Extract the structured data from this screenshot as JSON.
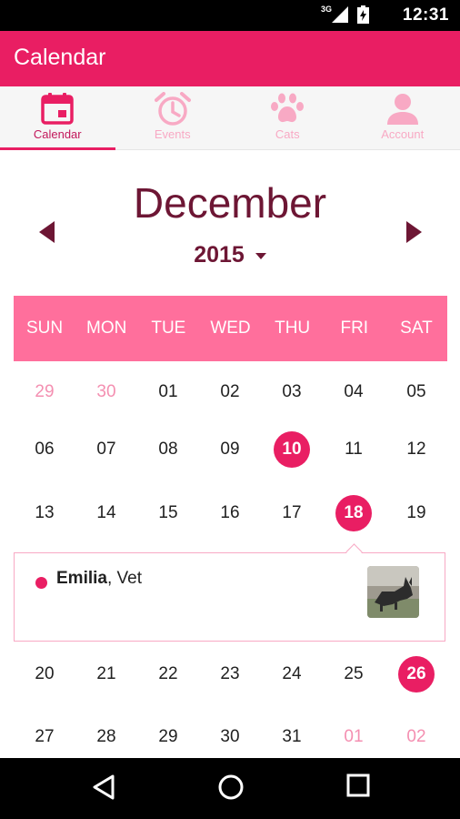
{
  "status_bar": {
    "network": "3G",
    "time": "12:31"
  },
  "app_bar": {
    "title": "Calendar"
  },
  "tabs": [
    {
      "label": "Calendar",
      "icon": "calendar-icon",
      "active": true
    },
    {
      "label": "Events",
      "icon": "alarm-clock-icon",
      "active": false
    },
    {
      "label": "Cats",
      "icon": "paw-icon",
      "active": false
    },
    {
      "label": "Account",
      "icon": "person-icon",
      "active": false
    }
  ],
  "calendar": {
    "month": "December",
    "year": "2015",
    "weekdays": [
      "SUN",
      "MON",
      "TUE",
      "WED",
      "THU",
      "FRI",
      "SAT"
    ],
    "weeks": [
      [
        {
          "d": "29",
          "muted": true
        },
        {
          "d": "30",
          "muted": true
        },
        {
          "d": "01"
        },
        {
          "d": "02"
        },
        {
          "d": "03"
        },
        {
          "d": "04"
        },
        {
          "d": "05"
        }
      ],
      [
        {
          "d": "06"
        },
        {
          "d": "07"
        },
        {
          "d": "08"
        },
        {
          "d": "09"
        },
        {
          "d": "10",
          "event": true
        },
        {
          "d": "11"
        },
        {
          "d": "12"
        }
      ],
      [
        {
          "d": "13"
        },
        {
          "d": "14"
        },
        {
          "d": "15"
        },
        {
          "d": "16"
        },
        {
          "d": "17"
        },
        {
          "d": "18",
          "event": true
        },
        {
          "d": "19"
        }
      ],
      [
        {
          "d": "20"
        },
        {
          "d": "21"
        },
        {
          "d": "22"
        },
        {
          "d": "23"
        },
        {
          "d": "24"
        },
        {
          "d": "25"
        },
        {
          "d": "26",
          "event": true
        }
      ],
      [
        {
          "d": "27"
        },
        {
          "d": "28"
        },
        {
          "d": "29"
        },
        {
          "d": "30"
        },
        {
          "d": "31"
        },
        {
          "d": "01",
          "muted": true
        },
        {
          "d": "02",
          "muted": true
        }
      ]
    ]
  },
  "event": {
    "name": "Emilia",
    "detail": ", Vet"
  },
  "colors": {
    "primary": "#e91e63",
    "header": "#ff6f9c",
    "title": "#6d1634",
    "muted": "#f48fb1"
  }
}
